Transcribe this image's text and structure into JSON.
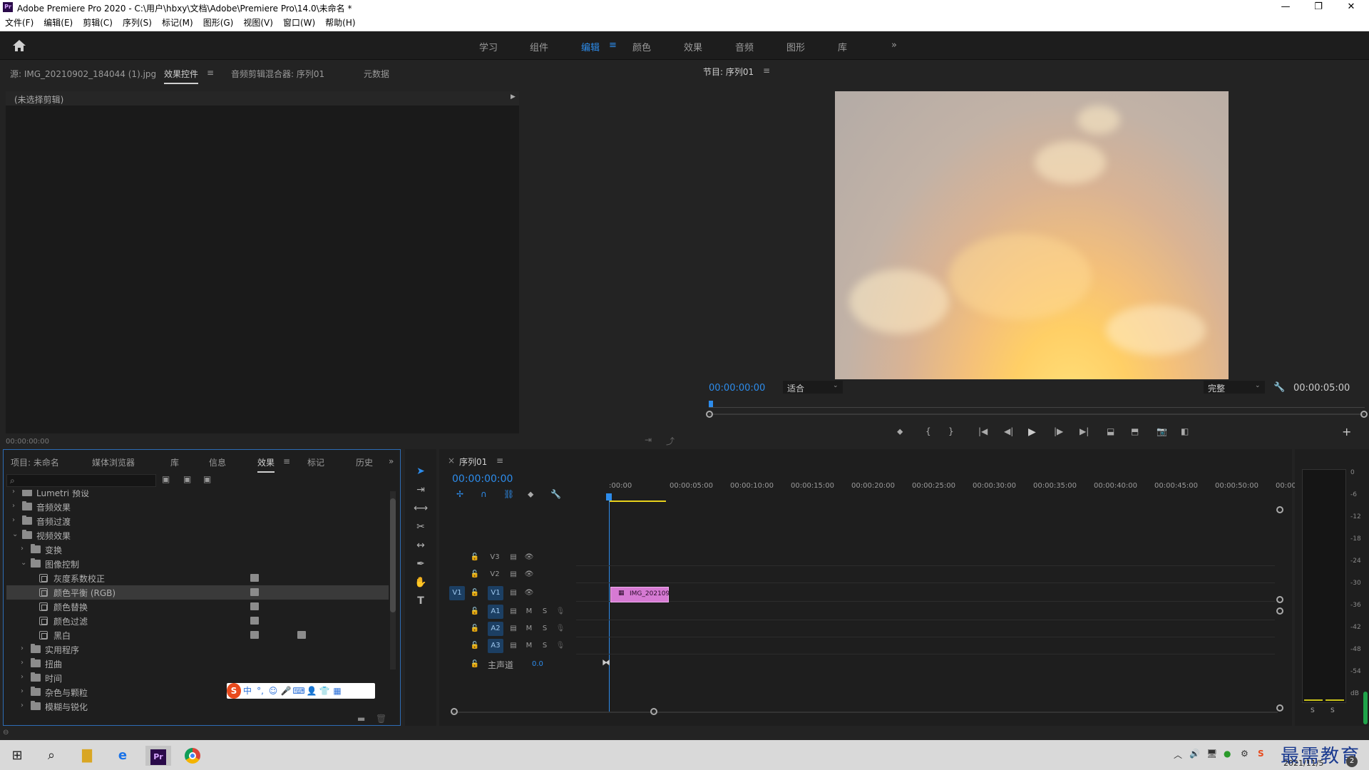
{
  "window": {
    "logo": "Pr",
    "title": "Adobe Premiere Pro 2020 - C:\\用户\\hbxy\\文档\\Adobe\\Premiere Pro\\14.0\\未命名 *",
    "minimize": "—",
    "restore": "❐",
    "close": "✕"
  },
  "menubar": [
    "文件(F)",
    "编辑(E)",
    "剪辑(C)",
    "序列(S)",
    "标记(M)",
    "图形(G)",
    "视图(V)",
    "窗口(W)",
    "帮助(H)"
  ],
  "workspaces": {
    "items": [
      "学习",
      "组件",
      "编辑",
      "颜色",
      "效果",
      "音频",
      "图形",
      "库"
    ],
    "active": "编辑",
    "overflow": "»",
    "menu": "≡"
  },
  "source_panel": {
    "tabs": [
      "源: IMG_20210902_184044 (1).jpg",
      "效果控件",
      "音频剪辑混合器: 序列01",
      "元数据"
    ],
    "active_tab_menu": "≡",
    "no_clip": "(未选择剪辑)",
    "timecode": "00:00:00:00"
  },
  "program_monitor": {
    "title": "节目: 序列01",
    "menu": "≡",
    "timecode": "00:00:00:00",
    "fit": "适合",
    "quality": "完整",
    "duration": "00:00:05:00"
  },
  "project_panel": {
    "tabs": [
      "项目: 未命名",
      "媒体浏览器",
      "库",
      "信息",
      "效果",
      "标记",
      "历史"
    ],
    "active_tab": "效果",
    "menu": "≡",
    "overflow": "»",
    "tree": [
      {
        "label": "Lumetri 预设",
        "level": 0,
        "expanded": false
      },
      {
        "label": "音频效果",
        "level": 0,
        "expanded": false
      },
      {
        "label": "音频过渡",
        "level": 0,
        "expanded": false
      },
      {
        "label": "视频效果",
        "level": 0,
        "expanded": true
      },
      {
        "label": "变换",
        "level": 1,
        "expanded": false
      },
      {
        "label": "图像控制",
        "level": 1,
        "expanded": true
      },
      {
        "label": "灰度系数校正",
        "level": 2,
        "effect": true
      },
      {
        "label": "颜色平衡 (RGB)",
        "level": 2,
        "effect": true,
        "selected": true
      },
      {
        "label": "颜色替换",
        "level": 2,
        "effect": true
      },
      {
        "label": "颜色过滤",
        "level": 2,
        "effect": true
      },
      {
        "label": "黑白",
        "level": 2,
        "effect": true,
        "extra_badge": true
      },
      {
        "label": "实用程序",
        "level": 1,
        "expanded": false
      },
      {
        "label": "扭曲",
        "level": 1,
        "expanded": false
      },
      {
        "label": "时间",
        "level": 1,
        "expanded": false
      },
      {
        "label": "杂色与颗粒",
        "level": 1,
        "expanded": false
      },
      {
        "label": "模糊与锐化",
        "level": 1,
        "expanded": false
      }
    ]
  },
  "timeline": {
    "title": "序列01",
    "menu": "≡",
    "close": "×",
    "timecode": "00:00:00:00",
    "ruler": [
      ":00:00",
      "00:00:05:00",
      "00:00:10:00",
      "00:00:15:00",
      "00:00:20:00",
      "00:00:25:00",
      "00:00:30:00",
      "00:00:35:00",
      "00:00:40:00",
      "00:00:45:00",
      "00:00:50:00",
      "00:00:0"
    ],
    "video_tracks": [
      "V3",
      "V2",
      "V1"
    ],
    "audio_tracks": [
      "A1",
      "A2",
      "A3"
    ],
    "source_patch": "V1",
    "master": {
      "label": "主声道",
      "value": "0.0"
    },
    "mute": "M",
    "solo": "S",
    "clip": "IMG_202109"
  },
  "meter": {
    "scale": [
      "0",
      "-6",
      "-12",
      "-18",
      "-24",
      "-30",
      "-36",
      "-42",
      "-48",
      "-54",
      "dB"
    ],
    "solo_left": "S",
    "solo_right": "S"
  },
  "ime": [
    "中",
    "°,",
    "☺",
    "🎤",
    "⌨",
    "👤",
    "👕",
    "▦"
  ],
  "watermark": "最需教育",
  "taskbar": {
    "date": "2021/11/5",
    "clock": "",
    "notification": "2",
    "premiere_label": "Pr"
  },
  "colors": {
    "accent": "#2d8ceb",
    "panel_bg": "#1e1e1e",
    "clip": "#d67ad3",
    "track_tag": "#1c3f63"
  }
}
